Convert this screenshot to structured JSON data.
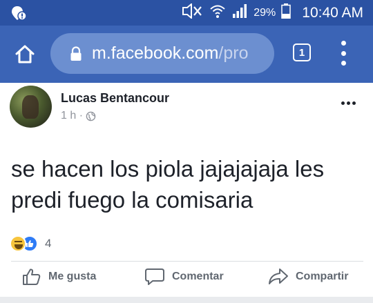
{
  "status_bar": {
    "battery_percent": "29%",
    "time": "10:40 AM"
  },
  "browser": {
    "url_host": "m.facebook.com",
    "url_path": "/pro",
    "tab_count": "1"
  },
  "post": {
    "author": "Lucas Bentancour",
    "time_ago": "1 h ·",
    "text": "se hacen los piola jajajajaja les predi fuego la comisaria",
    "reaction_count": "4"
  },
  "actions": {
    "like_label": "Me gusta",
    "comment_label": "Comentar",
    "share_label": "Compartir"
  },
  "colors": {
    "status_bar_bg": "#2b52a3",
    "toolbar_bg": "#3b64b6",
    "urlbar_bg": "#6c8fd0",
    "text_primary": "#1d2129",
    "text_secondary": "#606770"
  },
  "icons": {
    "status_left": "location-alert-icon",
    "status_right": [
      "mute-icon",
      "wifi-icon",
      "signal-icon",
      "battery-icon"
    ],
    "toolbar": [
      "home-icon",
      "lock-icon",
      "tabs-icon",
      "overflow-menu-icon"
    ],
    "post": [
      "globe-icon",
      "more-options-icon",
      "haha-reaction-icon",
      "like-reaction-icon"
    ],
    "actions": [
      "thumbs-up-icon",
      "comment-icon",
      "share-icon"
    ]
  }
}
